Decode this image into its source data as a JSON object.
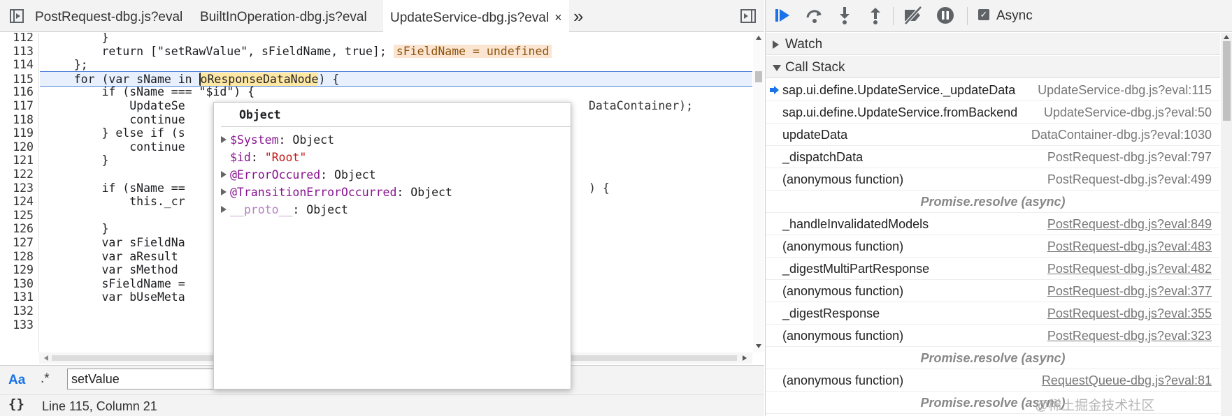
{
  "editor": {
    "tabs": [
      {
        "label": "PostRequest-dbg.js?eval"
      },
      {
        "label": "BuiltInOperation-dbg.js?eval"
      },
      {
        "label": "UpdateService-dbg.js?eval",
        "close": "×"
      }
    ],
    "more_tabs": "»",
    "lines": [
      {
        "n": "112",
        "text": "        }"
      },
      {
        "n": "113",
        "text": "        return [\"setRawValue\", sFieldName, true];",
        "inline": "sFieldName = undefined"
      },
      {
        "n": "114",
        "text": "    };"
      },
      {
        "n": "115",
        "pre": "    for (var sName in ",
        "var": "oResponseDataNode",
        "post": ") {"
      },
      {
        "n": "116",
        "text": "        if (sName === \"$id\") {"
      },
      {
        "n": "117",
        "text": "            UpdateSe",
        "tail": "DataContainer);"
      },
      {
        "n": "118",
        "text": "            continue"
      },
      {
        "n": "119",
        "text": "        } else if (s"
      },
      {
        "n": "120",
        "text": "            continue"
      },
      {
        "n": "121",
        "text": "        }"
      },
      {
        "n": "122",
        "text": ""
      },
      {
        "n": "123",
        "text": "        if (sName ==",
        "tail": ") {"
      },
      {
        "n": "124",
        "text": "            this._cr"
      },
      {
        "n": "125",
        "text": ""
      },
      {
        "n": "126",
        "text": "        }"
      },
      {
        "n": "127",
        "text": "        var sFieldNa"
      },
      {
        "n": "128",
        "text": "        var aResult "
      },
      {
        "n": "129",
        "text": "        var sMethod "
      },
      {
        "n": "130",
        "text": "        sFieldName ="
      },
      {
        "n": "131",
        "text": "        var bUseMeta"
      },
      {
        "n": "132",
        "text": ""
      },
      {
        "n": "133",
        "text": ""
      }
    ],
    "search": {
      "match_case": "Aa",
      "regex": ".*",
      "value": "setValue"
    },
    "status": {
      "pretty_print": "{}",
      "position": "Line 115, Column 21"
    }
  },
  "popover": {
    "title": "Object",
    "props": [
      {
        "name": "$System",
        "value": "Object",
        "expandable": true
      },
      {
        "name": "$id",
        "value": "\"Root\"",
        "expandable": false,
        "is_string": true
      },
      {
        "name": "@ErrorOccured",
        "value": "Object",
        "expandable": true
      },
      {
        "name": "@TransitionErrorOccurred",
        "value": "Object",
        "expandable": true
      },
      {
        "name": "__proto__",
        "value": "Object",
        "expandable": true,
        "dim": true
      }
    ]
  },
  "debugger": {
    "toolbar": {
      "async_label": "Async",
      "async_checked": "✓"
    },
    "sections": {
      "watch": "Watch",
      "call_stack": "Call Stack"
    },
    "frames": [
      {
        "kind": "frame",
        "name": "sap.ui.define.UpdateService._updateData",
        "loc": "UpdateService-dbg.js?eval:115",
        "current": true,
        "link": false
      },
      {
        "kind": "frame",
        "name": "sap.ui.define.UpdateService.fromBackend",
        "loc": "UpdateService-dbg.js?eval:50",
        "link": false
      },
      {
        "kind": "frame",
        "name": "updateData",
        "loc": "DataContainer-dbg.js?eval:1030",
        "link": false
      },
      {
        "kind": "frame",
        "name": "_dispatchData",
        "loc": "PostRequest-dbg.js?eval:797",
        "link": false
      },
      {
        "kind": "frame",
        "name": "(anonymous function)",
        "loc": "PostRequest-dbg.js?eval:499",
        "link": false
      },
      {
        "kind": "async",
        "name": "Promise.resolve (async)"
      },
      {
        "kind": "frame",
        "name": "_handleInvalidatedModels",
        "loc": "PostRequest-dbg.js?eval:849",
        "link": true
      },
      {
        "kind": "frame",
        "name": "(anonymous function)",
        "loc": "PostRequest-dbg.js?eval:483",
        "link": true
      },
      {
        "kind": "frame",
        "name": "_digestMultiPartResponse",
        "loc": "PostRequest-dbg.js?eval:482",
        "link": true
      },
      {
        "kind": "frame",
        "name": "(anonymous function)",
        "loc": "PostRequest-dbg.js?eval:377",
        "link": true
      },
      {
        "kind": "frame",
        "name": "_digestResponse",
        "loc": "PostRequest-dbg.js?eval:355",
        "link": true
      },
      {
        "kind": "frame",
        "name": "(anonymous function)",
        "loc": "PostRequest-dbg.js?eval:323",
        "link": true
      },
      {
        "kind": "async",
        "name": "Promise.resolve (async)"
      },
      {
        "kind": "frame",
        "name": "(anonymous function)",
        "loc": "RequestQueue-dbg.js?eval:81",
        "link": true
      },
      {
        "kind": "async",
        "name": "Promise.resolve (async)"
      }
    ]
  },
  "watermark": "@稀土掘金技术社区"
}
